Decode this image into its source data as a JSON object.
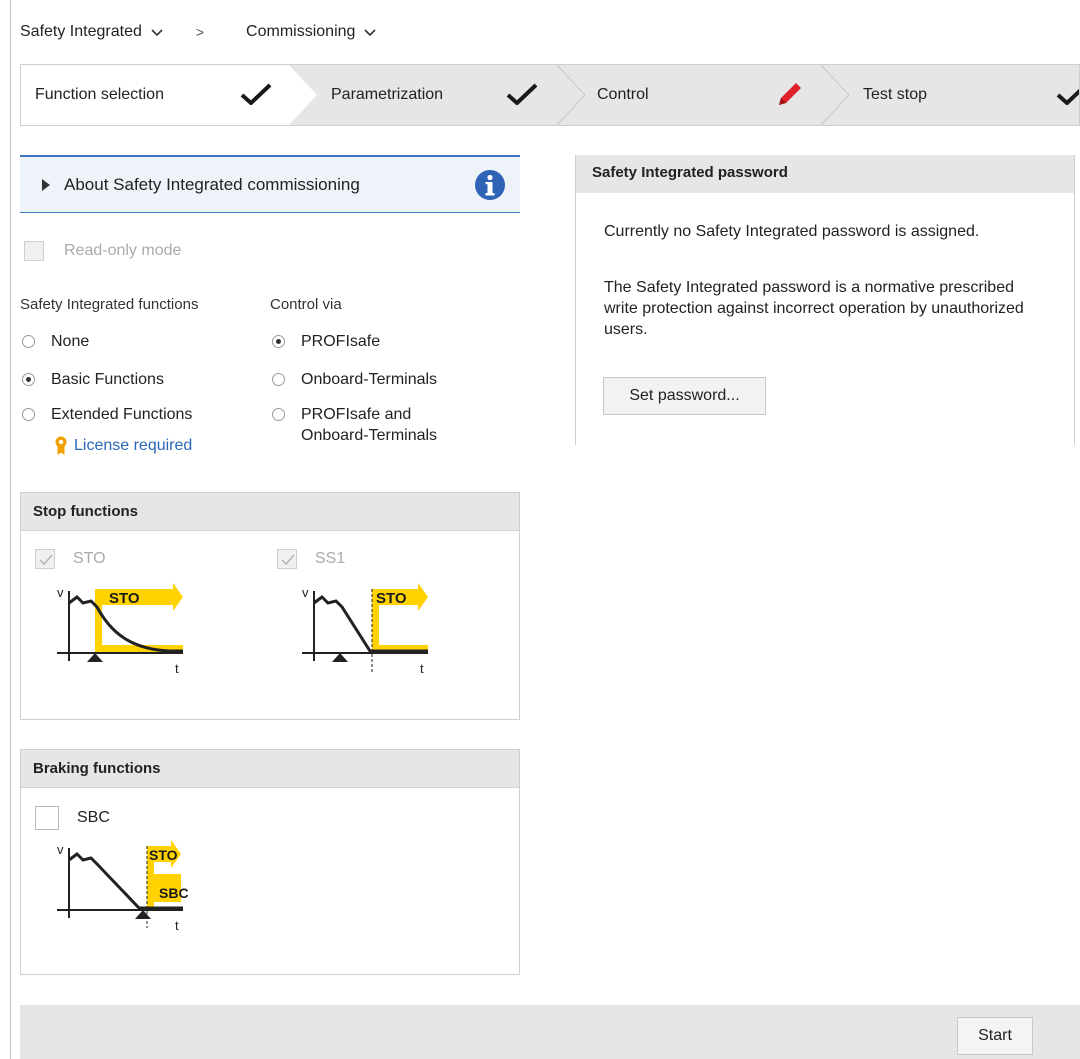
{
  "breadcrumb": {
    "root_label": "Safety Integrated",
    "separator": ">",
    "current_label": "Commissioning"
  },
  "stepper": {
    "steps": [
      {
        "label": "Function selection",
        "status": "done"
      },
      {
        "label": "Parametrization",
        "status": "done"
      },
      {
        "label": "Control",
        "status": "editing"
      },
      {
        "label": "Test stop",
        "status": "done"
      }
    ]
  },
  "about": {
    "label": "About Safety Integrated commissioning"
  },
  "readonly": {
    "label": "Read-only mode",
    "checked": false
  },
  "functions": {
    "heading": "Safety Integrated functions",
    "options": [
      "None",
      "Basic Functions",
      "Extended Functions"
    ],
    "selected": "Basic Functions",
    "license_label": "License required"
  },
  "control": {
    "heading": "Control via",
    "options": [
      "PROFIsafe",
      "Onboard-Terminals",
      "PROFIsafe and\nOnboard-Terminals"
    ],
    "option3_line1": "PROFIsafe and",
    "option3_line2": "Onboard-Terminals",
    "selected": "PROFIsafe"
  },
  "stop_functions": {
    "title": "Stop functions",
    "sto_label": "STO",
    "ss1_label": "SS1",
    "diagram_tag_sto": "STO",
    "axis_v": "v",
    "axis_t": "t"
  },
  "braking_functions": {
    "title": "Braking functions",
    "sbc_label": "SBC",
    "diagram_tag_sto": "STO",
    "diagram_tag_sbc": "SBC"
  },
  "password": {
    "title": "Safety Integrated password",
    "status_text": "Currently no Safety Integrated password is assigned.",
    "desc_text": "The Safety Integrated password is a normative prescribed write protection against incorrect operation by unauthorized users.",
    "set_button": "Set password..."
  },
  "footer": {
    "start_button": "Start"
  },
  "colors": {
    "accent_blue": "#3a78c6",
    "safety_yellow": "#ffd200",
    "edit_red": "#e0202a"
  }
}
